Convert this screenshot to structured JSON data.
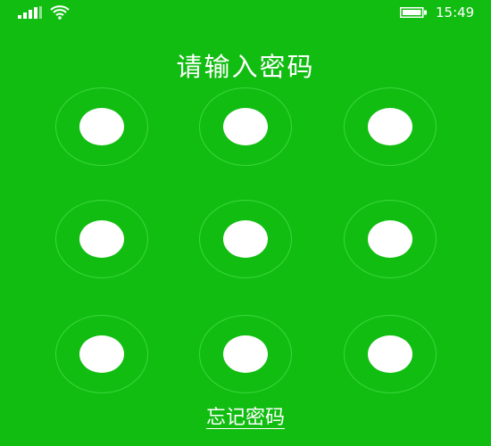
{
  "status_bar": {
    "signal_icon": "cellular-signal-icon",
    "wifi_icon": "wifi-icon",
    "battery_icon": "battery-icon",
    "time": "15:49"
  },
  "title": "请输入密码",
  "pattern": {
    "rows": 3,
    "columns": 3,
    "nodes": [
      "1",
      "2",
      "3",
      "4",
      "5",
      "6",
      "7",
      "8",
      "9"
    ]
  },
  "forgot_password": "忘记密码",
  "colors": {
    "background": "#12bd12",
    "ring": "#3bd83b",
    "dot": "#ffffff",
    "text": "#ffffff"
  }
}
